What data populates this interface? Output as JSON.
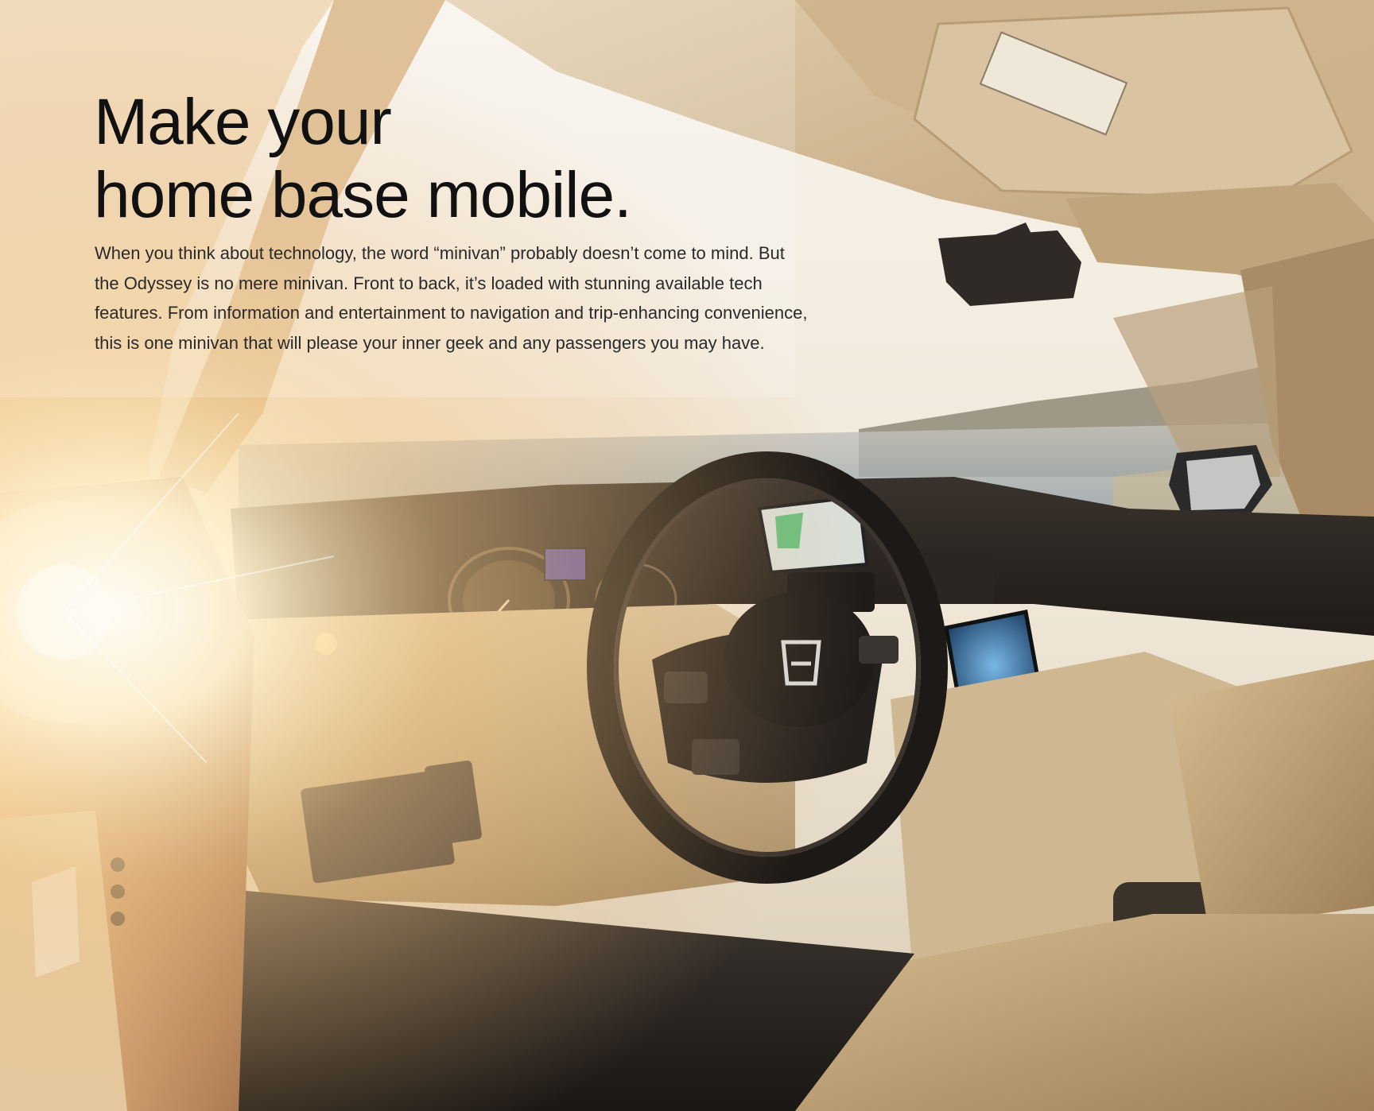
{
  "headline": {
    "line1": "Make your",
    "line2": "home base mobile."
  },
  "body": {
    "paragraph": "When you think about technology, the word “minivan” probably doesn’t come to mind. But the Odyssey is no mere minivan. Front to back, it’s loaded with stunning available tech features. From information and entertainment to navigation and trip-enhancing convenience, this is one minivan that will please your inner geek and any passengers you may have."
  },
  "photo": {
    "subject": "minivan-interior-with-steering-wheel-and-dashboard",
    "colors": {
      "sky": "#f4efe6",
      "sun": "#fff6dc",
      "headliner": "#c9b08a",
      "dashboard": "#2a2522",
      "leather": "#c7ab80",
      "sea": "#7d8a93"
    }
  }
}
